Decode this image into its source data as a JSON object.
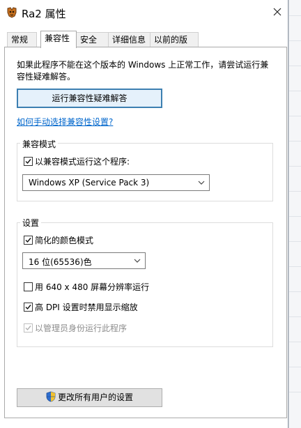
{
  "window": {
    "title": "Ra2 属性"
  },
  "tabs": [
    "常规",
    "兼容性",
    "安全",
    "详细信息",
    "以前的版本"
  ],
  "compat": {
    "intro": "如果此程序不能在这个版本的 Windows 上正常工作，请尝试运行兼容性疑难解答。",
    "troubleshoot_button": "运行兼容性疑难解答",
    "manual_link": "如何手动选择兼容性设置?",
    "mode_group": {
      "label": "兼容模式",
      "checkbox": "以兼容模式运行这个程序:",
      "checked": true,
      "selected": "Windows XP (Service Pack 3)"
    },
    "settings_group": {
      "label": "设置",
      "reduced_color": {
        "label": "简化的颜色模式",
        "checked": true
      },
      "color_select": "16 位(65536)色",
      "res_640": {
        "label": "用 640 x 480 屏幕分辨率运行",
        "checked": false
      },
      "high_dpi": {
        "label": "高 DPI 设置时禁用显示缩放",
        "checked": true
      },
      "run_admin": {
        "label": "以管理员身份运行此程序",
        "checked": true,
        "disabled": true
      }
    },
    "all_users_button": "更改所有用户的设置"
  },
  "icons": {
    "app": "ra2-app-icon",
    "close": "close-icon",
    "shield": "uac-shield-icon",
    "check": "check-icon",
    "chevron": "chevron-down-icon"
  },
  "colors": {
    "link": "#0066cc",
    "primary_border": "#3c7fb1",
    "disabled_text": "#8d8d8d"
  }
}
